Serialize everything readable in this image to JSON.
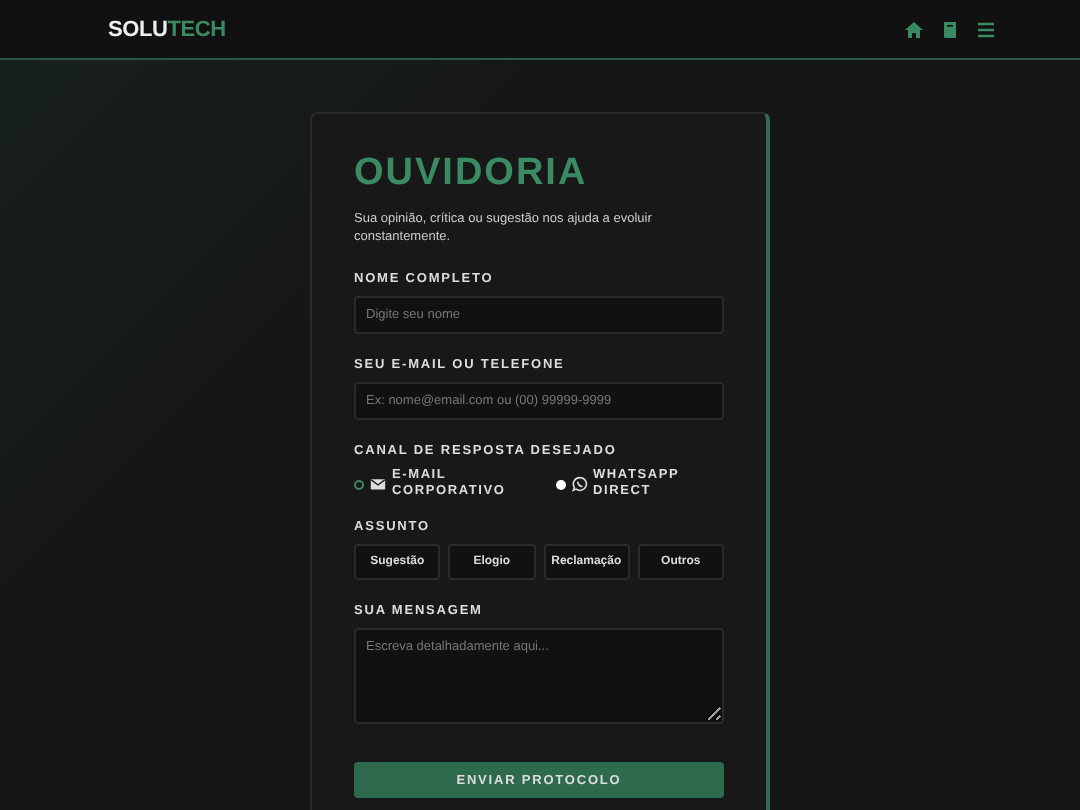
{
  "header": {
    "logo": {
      "text": "SOLU",
      "accent": "TECH"
    }
  },
  "form": {
    "title": "OUVIDORIA",
    "subtitle": "Sua opinião, crítica ou sugestão nos ajuda a evoluir constantemente.",
    "fields": [
      {
        "label": "NOME COMPLETO",
        "placeholder": "Digite seu nome"
      },
      {
        "label": "SEU E-MAIL OU TELEFONE",
        "placeholder": "Ex: nome@email.com ou (00) 99999-9999"
      }
    ],
    "channel": {
      "label": "CANAL DE RESPOSTA DESEJADO",
      "options": [
        {
          "label": "E-MAIL CORPORATIVO",
          "kind": "email",
          "selected": true
        },
        {
          "label": "WHATSAPP DIRECT",
          "kind": "whatsapp",
          "selected": false
        }
      ]
    },
    "subject": {
      "label": "ASSUNTO",
      "options": [
        {
          "label": "Sugestão",
          "selected": false
        },
        {
          "label": "Elogio",
          "selected": false
        },
        {
          "label": "Reclamação",
          "selected": false
        },
        {
          "label": "Outros",
          "selected": false
        }
      ]
    },
    "message": {
      "label": "SUA MENSAGEM",
      "placeholder": "Escreva detalhadamente aqui..."
    },
    "submit": "ENVIAR PROTOCOLO"
  }
}
